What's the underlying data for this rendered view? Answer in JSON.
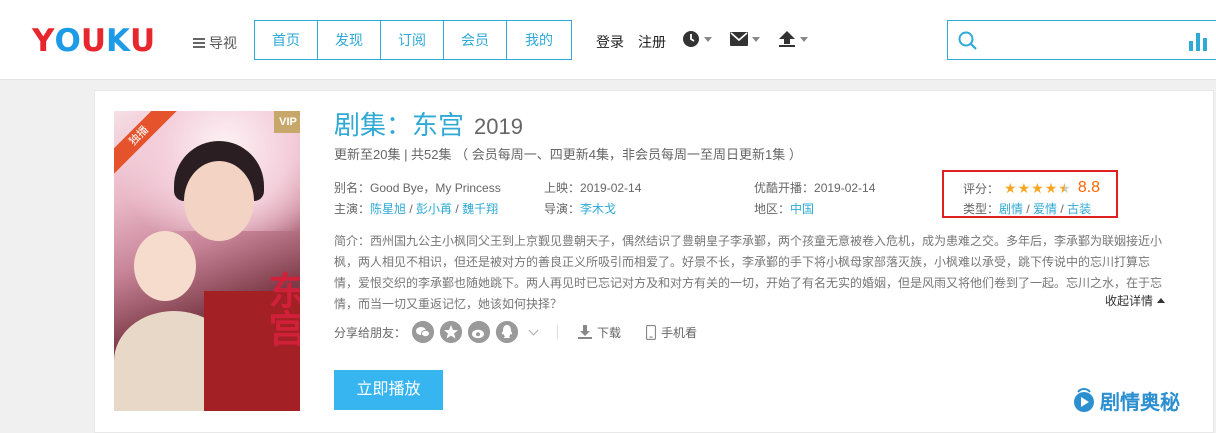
{
  "header": {
    "logo": {
      "letters": [
        "Y",
        "O",
        "U",
        "K",
        "U"
      ],
      "colors": [
        "#e8262d",
        "#1e9be6",
        "#e8262d",
        "#1e9be6",
        "#e8262d"
      ]
    },
    "guide_label": "导视",
    "tabs": [
      "首页",
      "发现",
      "订阅",
      "会员",
      "我的"
    ],
    "login_label": "登录",
    "register_label": "注册",
    "tools": [
      "history-icon",
      "message-icon",
      "upload-icon"
    ],
    "search": {
      "value": "",
      "placeholder": ""
    }
  },
  "show": {
    "title": "剧集：东宫",
    "year": "2019",
    "update_info": "更新至20集 | 共52集 （ 会员每周一、四更新4集，非会员每周一至周日更新1集 ）",
    "alias_label": "别名：",
    "alias": "Good Bye，My Princess",
    "release_label": "上映：",
    "release": "2019-02-14",
    "youku_label": "优酷开播：",
    "youku_date": "2019-02-14",
    "cast_label": "主演：",
    "cast": [
      "陈星旭",
      "彭小苒",
      "魏千翔"
    ],
    "director_label": "导演：",
    "director": "李木戈",
    "region_label": "地区：",
    "region": "中国",
    "rating_label": "评分：",
    "rating_stars": 4.5,
    "score": "8.8",
    "genre_label": "类型：",
    "genres": [
      "剧情",
      "爱情",
      "古装"
    ],
    "summary": "简介：西州国九公主小枫同父王到上京觐见豊朝天子，偶然结识了豊朝皇子李承鄞，两个孩童无意被卷入危机，成为患难之交。多年后，李承鄞为联姻接近小枫，两人相见不相识，但还是被对方的善良正义所吸引而相爱了。好景不长，李承鄞的手下将小枫母家部落灭族，小枫难以承受，跳下传说中的忘川打算忘情，爱恨交织的李承鄞也随她跳下。两人再见时已忘记对方及和对方有关的一切，开始了有名无实的婚姻，但是风雨又将他们卷到了一起。忘川之水，在于忘情，而当一切又重返记忆，她该如何抉择？",
    "collapse_label": "收起详情",
    "share_label": "分享给朋友：",
    "download_label": "下载",
    "mobile_label": "手机看",
    "play_label": "立即播放",
    "vip_badge": "VIP",
    "exclusive_badge": "独播",
    "poster_text": "东宫"
  },
  "watermark": "剧情奥秘"
}
